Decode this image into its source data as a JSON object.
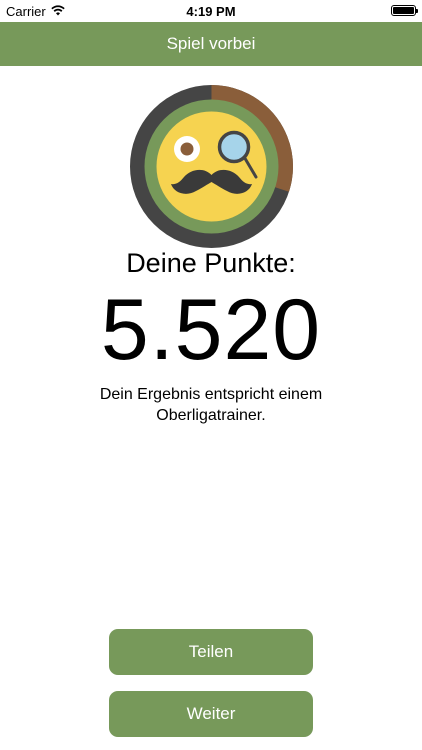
{
  "status_bar": {
    "carrier": "Carrier",
    "time": "4:19 PM",
    "icons": [
      "wifi-icon",
      "battery-icon"
    ]
  },
  "nav": {
    "title": "Spiel vorbei"
  },
  "badge": {
    "icon": "monocle-mustache-face-icon",
    "ring_progress": 0.3,
    "colors": {
      "outer_ring": "#454545",
      "progress_ring": "#8a5e3a",
      "inner_ring": "#77995a",
      "face": "#f6d350"
    }
  },
  "score": {
    "title": "Deine Punkte:",
    "value": "5.520"
  },
  "result": {
    "text": "Dein Ergebnis entspricht einem Oberligatrainer."
  },
  "buttons": {
    "share_label": "Teilen",
    "next_label": "Weiter"
  },
  "colors": {
    "accent": "#77995a",
    "background": "#ffffff"
  }
}
